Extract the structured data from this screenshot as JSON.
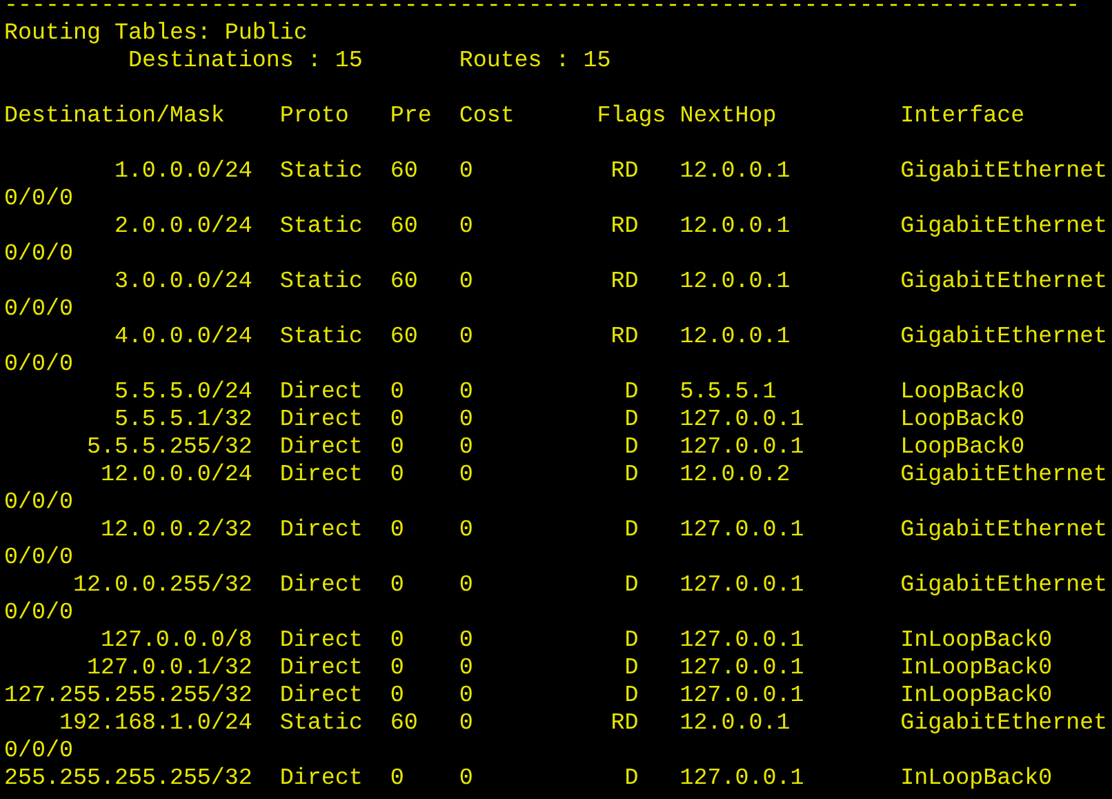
{
  "separator": "------------------------------------------------------------------------------",
  "title": "Routing Tables: Public",
  "summary": {
    "destinations": "Destinations : 15",
    "routes": "Routes : 15"
  },
  "columns": [
    "Destination/Mask",
    "Proto",
    "Pre",
    "Cost",
    "Flags",
    "NextHop",
    "Interface"
  ],
  "rows": [
    {
      "destination": "1.0.0.0/24",
      "proto": "Static",
      "pre": "60",
      "cost": "0",
      "flags": "RD",
      "nexthop": "12.0.0.1",
      "interface": "GigabitEthernet",
      "continuation": "0/0/0"
    },
    {
      "destination": "2.0.0.0/24",
      "proto": "Static",
      "pre": "60",
      "cost": "0",
      "flags": "RD",
      "nexthop": "12.0.0.1",
      "interface": "GigabitEthernet",
      "continuation": "0/0/0"
    },
    {
      "destination": "3.0.0.0/24",
      "proto": "Static",
      "pre": "60",
      "cost": "0",
      "flags": "RD",
      "nexthop": "12.0.0.1",
      "interface": "GigabitEthernet",
      "continuation": "0/0/0"
    },
    {
      "destination": "4.0.0.0/24",
      "proto": "Static",
      "pre": "60",
      "cost": "0",
      "flags": "RD",
      "nexthop": "12.0.0.1",
      "interface": "GigabitEthernet",
      "continuation": "0/0/0"
    },
    {
      "destination": "5.5.5.0/24",
      "proto": "Direct",
      "pre": "0",
      "cost": "0",
      "flags": "D",
      "nexthop": "5.5.5.1",
      "interface": "LoopBack0"
    },
    {
      "destination": "5.5.5.1/32",
      "proto": "Direct",
      "pre": "0",
      "cost": "0",
      "flags": "D",
      "nexthop": "127.0.0.1",
      "interface": "LoopBack0"
    },
    {
      "destination": "5.5.5.255/32",
      "proto": "Direct",
      "pre": "0",
      "cost": "0",
      "flags": "D",
      "nexthop": "127.0.0.1",
      "interface": "LoopBack0"
    },
    {
      "destination": "12.0.0.0/24",
      "proto": "Direct",
      "pre": "0",
      "cost": "0",
      "flags": "D",
      "nexthop": "12.0.0.2",
      "interface": "GigabitEthernet",
      "continuation": "0/0/0"
    },
    {
      "destination": "12.0.0.2/32",
      "proto": "Direct",
      "pre": "0",
      "cost": "0",
      "flags": "D",
      "nexthop": "127.0.0.1",
      "interface": "GigabitEthernet",
      "continuation": "0/0/0"
    },
    {
      "destination": "12.0.0.255/32",
      "proto": "Direct",
      "pre": "0",
      "cost": "0",
      "flags": "D",
      "nexthop": "127.0.0.1",
      "interface": "GigabitEthernet",
      "continuation": "0/0/0"
    },
    {
      "destination": "127.0.0.0/8",
      "proto": "Direct",
      "pre": "0",
      "cost": "0",
      "flags": "D",
      "nexthop": "127.0.0.1",
      "interface": "InLoopBack0"
    },
    {
      "destination": "127.0.0.1/32",
      "proto": "Direct",
      "pre": "0",
      "cost": "0",
      "flags": "D",
      "nexthop": "127.0.0.1",
      "interface": "InLoopBack0"
    },
    {
      "destination": "127.255.255.255/32",
      "proto": "Direct",
      "pre": "0",
      "cost": "0",
      "flags": "D",
      "nexthop": "127.0.0.1",
      "interface": "InLoopBack0"
    },
    {
      "destination": "192.168.1.0/24",
      "proto": "Static",
      "pre": "60",
      "cost": "0",
      "flags": "RD",
      "nexthop": "12.0.0.1",
      "interface": "GigabitEthernet",
      "continuation": "0/0/0"
    },
    {
      "destination": "255.255.255.255/32",
      "proto": "Direct",
      "pre": "0",
      "cost": "0",
      "flags": "D",
      "nexthop": "127.0.0.1",
      "interface": "InLoopBack0"
    }
  ]
}
